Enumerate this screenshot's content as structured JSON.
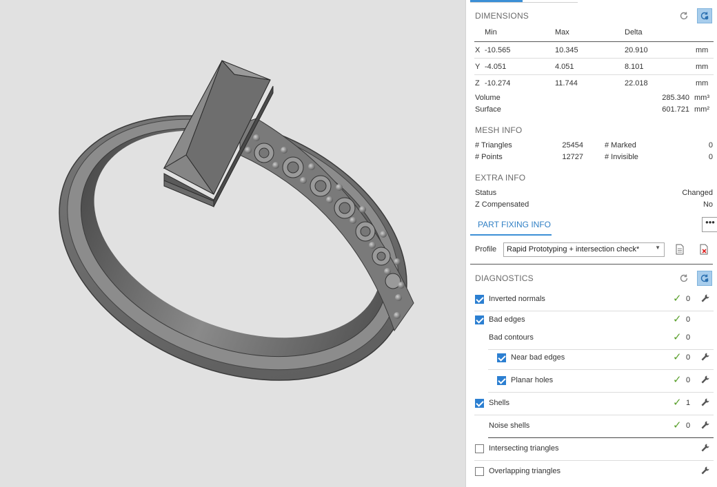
{
  "dimensions": {
    "title": "DIMENSIONS",
    "headers": [
      "Min",
      "Max",
      "Delta"
    ],
    "rows": [
      {
        "axis": "X",
        "min": "-10.565",
        "max": "10.345",
        "delta": "20.910",
        "unit": "mm"
      },
      {
        "axis": "Y",
        "min": "-4.051",
        "max": "4.051",
        "delta": "8.101",
        "unit": "mm"
      },
      {
        "axis": "Z",
        "min": "-10.274",
        "max": "11.744",
        "delta": "22.018",
        "unit": "mm"
      }
    ],
    "volume_label": "Volume",
    "volume_value": "285.340",
    "volume_unit": "mm³",
    "surface_label": "Surface",
    "surface_value": "601.721",
    "surface_unit": "mm²"
  },
  "mesh_info": {
    "title": "MESH INFO",
    "triangles_label": "# Triangles",
    "triangles_value": "25454",
    "points_label": "# Points",
    "points_value": "12727",
    "marked_label": "# Marked",
    "marked_value": "0",
    "invisible_label": "# Invisible",
    "invisible_value": "0"
  },
  "extra_info": {
    "title": "EXTRA INFO",
    "status_label": "Status",
    "status_value": "Changed",
    "zcomp_label": "Z Compensated",
    "zcomp_value": "No"
  },
  "part_fixing": {
    "tab_label": "PART FIXING INFO",
    "more_label": "•••",
    "profile_label": "Profile",
    "profile_value": "Rapid Prototyping + intersection check*"
  },
  "diagnostics": {
    "title": "DIAGNOSTICS",
    "items": [
      {
        "label": "Inverted normals",
        "checked": true,
        "count": "0"
      },
      {
        "label": "Bad edges",
        "checked": true,
        "count": "0"
      },
      {
        "label": "Bad contours",
        "count": "0"
      },
      {
        "label": "Near bad edges",
        "checked": true,
        "count": "0"
      },
      {
        "label": "Planar holes",
        "checked": true,
        "count": "0"
      },
      {
        "label": "Shells",
        "checked": true,
        "count": "1"
      },
      {
        "label": "Noise shells",
        "count": "0"
      },
      {
        "label": "Intersecting triangles",
        "checked": false
      },
      {
        "label": "Overlapping triangles",
        "checked": false
      }
    ]
  },
  "colors": {
    "accent": "#3b8fd6",
    "ok_tick": "#5aa02c",
    "checkbox_on": "#2c7fd1",
    "viewport_bg": "#e1e1e1",
    "model_gray": "#6e6e6e"
  },
  "icons": [
    "refresh-icon",
    "auto-refresh-icon",
    "more-icon",
    "profile-doc-icon",
    "profile-delete-icon",
    "checkmark-icon",
    "wrench-icon",
    "dropdown-arrow-icon"
  ]
}
